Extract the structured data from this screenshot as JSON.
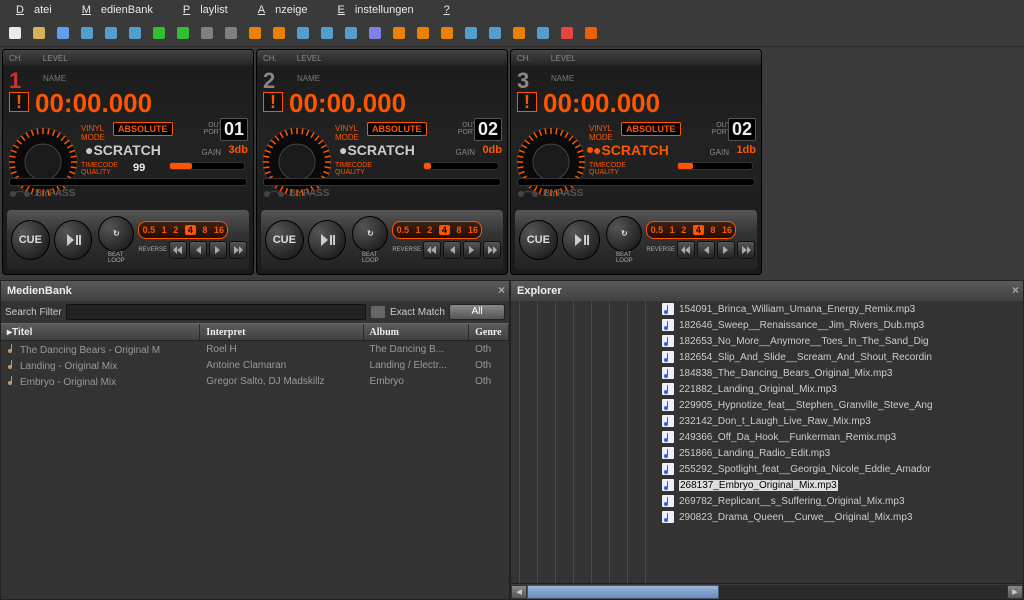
{
  "menu": [
    "Datei",
    "MedienBank",
    "Playlist",
    "Anzeige",
    "Einstellungen",
    "?"
  ],
  "toolbar_icons": [
    "file-new",
    "folder-open",
    "search",
    "disc",
    "stop",
    "pause",
    "refresh",
    "play-green",
    "skip",
    "skip2",
    "list1",
    "list2",
    "list3",
    "grid",
    "list4",
    "wand",
    "wave",
    "band",
    "globe-orange",
    "globe-wave",
    "globe-blue",
    "pie",
    "globe",
    "x",
    "fire"
  ],
  "decks": [
    {
      "ch": "1",
      "time": "00:00.000",
      "vinyl": "VINYL",
      "mode": "MODE",
      "abs": "ABSOLUTE",
      "out": "OUT",
      "port": "PORT",
      "outport": "01",
      "scratch": "SCRATCH",
      "gainlbl": "GAIN",
      "gain": "3db",
      "tc": "TIMECODE",
      "quality": "QUALITY",
      "tcval": "99",
      "gainfill": 30,
      "bypass": "BYPASS",
      "cue": "CUE",
      "rates": [
        "0.5",
        "1",
        "2",
        "4",
        "8",
        "16"
      ],
      "active_rate": 3,
      "reverse": "REVERSE"
    },
    {
      "ch": "2",
      "time": "00:00.000",
      "vinyl": "VINYL",
      "mode": "MODE",
      "abs": "ABSOLUTE",
      "out": "OUT",
      "port": "PORT",
      "outport": "02",
      "scratch": "SCRATCH",
      "gainlbl": "GAIN",
      "gain": "0db",
      "tc": "TIMECODE",
      "quality": "QUALITY",
      "tcval": "",
      "gainfill": 10,
      "bypass": "BYPASS",
      "cue": "CUE",
      "rates": [
        "0.5",
        "1",
        "2",
        "4",
        "8",
        "16"
      ],
      "active_rate": 3,
      "reverse": "REVERSE"
    },
    {
      "ch": "3",
      "time": "00:00.000",
      "vinyl": "VINYL",
      "mode": "MODE",
      "abs": "ABSOLUTE",
      "out": "OUT",
      "port": "PORT",
      "outport": "02",
      "scratch": "SCRATCH",
      "gainlbl": "GAIN",
      "gain": "1db",
      "tc": "TIMECODE",
      "quality": "QUALITY",
      "tcval": "",
      "gainfill": 20,
      "bypass": "BYPASS",
      "cue": "CUE",
      "rates": [
        "0.5",
        "1",
        "2",
        "4",
        "8",
        "16"
      ],
      "active_rate": 3,
      "reverse": "REVERSE"
    }
  ],
  "beatloop": "BEAT\nLOOP",
  "medien": {
    "title": "MedienBank",
    "search_label": "Search Filter",
    "exact": "Exact Match",
    "all": "All",
    "cols": [
      "Titel",
      "Interpret",
      "Album",
      "Genre"
    ],
    "rows": [
      {
        "t": "The Dancing Bears - Original M",
        "i": "Roel H",
        "a": "The Dancing B...",
        "g": "Oth"
      },
      {
        "t": "Landing - Original Mix",
        "i": "Antoine Clamaran",
        "a": "Landing / Electr...",
        "g": "Oth"
      },
      {
        "t": "Embryo - Original Mix",
        "i": "Gregor Salto, DJ Madskillz",
        "a": "Embryo",
        "g": "Oth"
      }
    ]
  },
  "explorer": {
    "title": "Explorer",
    "files": [
      "154091_Brinca_William_Umana_Energy_Remix.mp3",
      "182646_Sweep__Renaissance__Jim_Rivers_Dub.mp3",
      "182653_No_More__Anymore__Toes_In_The_Sand_Dig",
      "182654_Slip_And_Slide__Scream_And_Shout_Recordin",
      "184838_The_Dancing_Bears_Original_Mix.mp3",
      "221882_Landing_Original_Mix.mp3",
      "229905_Hypnotize_feat__Stephen_Granville_Steve_Ang",
      "232142_Don_t_Laugh_Live_Raw_Mix.mp3",
      "249366_Off_Da_Hook__Funkerman_Remix.mp3",
      "251866_Landing_Radio_Edit.mp3",
      "255292_Spotlight_feat__Georgia_Nicole_Eddie_Amador",
      "268137_Embryo_Original_Mix.mp3",
      "269782_Replicant__s_Suffering_Original_Mix.mp3",
      "290823_Drama_Queen__Curwe__Original_Mix.mp3"
    ],
    "selected": 11
  },
  "toplbl": {
    "ch": "CH.",
    "level": "LEVEL",
    "name": "NAME"
  }
}
